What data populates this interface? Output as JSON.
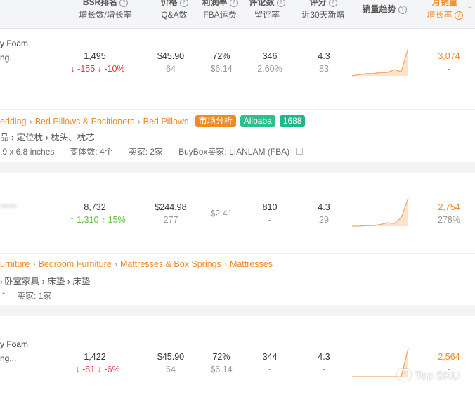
{
  "header": {
    "bsr": {
      "l1": "BSR排名",
      "l2": "增长数/增长率"
    },
    "price": {
      "l1": "价格",
      "l2": "Q&A数"
    },
    "margin": {
      "l1": "利润率",
      "l2": "FBA运费"
    },
    "reviews": {
      "l1": "评论数",
      "l2": "留评率"
    },
    "rating": {
      "l1": "评分",
      "l2": "近30天新增"
    },
    "trend": {
      "l1": "销量趋势"
    },
    "monthly": {
      "l1": "月销量",
      "l2": "增长率"
    }
  },
  "rows": [
    {
      "title_l1": "y Foam",
      "title_l2": "ng...",
      "bsr": "1,495",
      "bsr_change_count": "-155",
      "bsr_change_rate": "-10%",
      "bsr_dir": "down",
      "price": "$45.90",
      "qa": "64",
      "margin": "72%",
      "fba": "$6.14",
      "reviews": "346",
      "review_rate": "2.60%",
      "rating": "4.3",
      "rating_new": "83",
      "trend": [
        0,
        0.04,
        0.08,
        0.08,
        0.12,
        0.12,
        0.22,
        0.15,
        1.0
      ],
      "monthly": "3,074",
      "growth": "-"
    },
    {
      "title_l1": "",
      "title_l2": "",
      "bsr": "8,732",
      "bsr_change_count": "1,310",
      "bsr_change_rate": "15%",
      "bsr_dir": "up",
      "price": "$244.98",
      "qa": "277",
      "margin": "",
      "fba": "$2.41",
      "reviews": "810",
      "review_rate": "-",
      "rating": "4.3",
      "rating_new": "29",
      "trend": [
        0,
        0,
        0.02,
        0.02,
        0.06,
        0.12,
        0.1,
        0.3,
        1.0
      ],
      "monthly": "2,754",
      "growth": "278%"
    },
    {
      "title_l1": "y Foam",
      "title_l2": "ng...",
      "bsr": "1,422",
      "bsr_change_count": "-81",
      "bsr_change_rate": "-6%",
      "bsr_dir": "down",
      "price": "$45.90",
      "qa": "64",
      "margin": "72%",
      "fba": "$6.14",
      "reviews": "344",
      "review_rate": "-",
      "rating": "4.3",
      "rating_new": "-",
      "trend": [
        0,
        0,
        0,
        0,
        0,
        0,
        0,
        0,
        1.0
      ],
      "monthly": "2,564",
      "growth": "-"
    }
  ],
  "detail1": {
    "crumbs": [
      "edding",
      "Bed Pillows & Positioners",
      "Bed Pillows"
    ],
    "tags": [
      "市场分析",
      "Alibaba",
      "1688"
    ],
    "cn_crumbs": "品 › 定位枕 › 枕头、枕芯",
    "dims": ".9 x 6.8 inches",
    "variants": "变体数: 4个",
    "sellers": "卖家: 2家",
    "buybox": "BuyBox卖家: LIANLAM (FBA)"
  },
  "detail2": {
    "crumbs": [
      "urniture",
      "Bedroom Furniture",
      "Mattresses & Box Springs",
      "Mattresses"
    ],
    "cn_crumbs": "卧室家具 › 床垫 › 床垫",
    "sellers": "卖家: 1家"
  },
  "watermark": "Top SKU",
  "colors": {
    "accent": "#f08a24",
    "down": "#e03a3a",
    "up": "#67c23a",
    "tag_green": "#2dc08d"
  }
}
